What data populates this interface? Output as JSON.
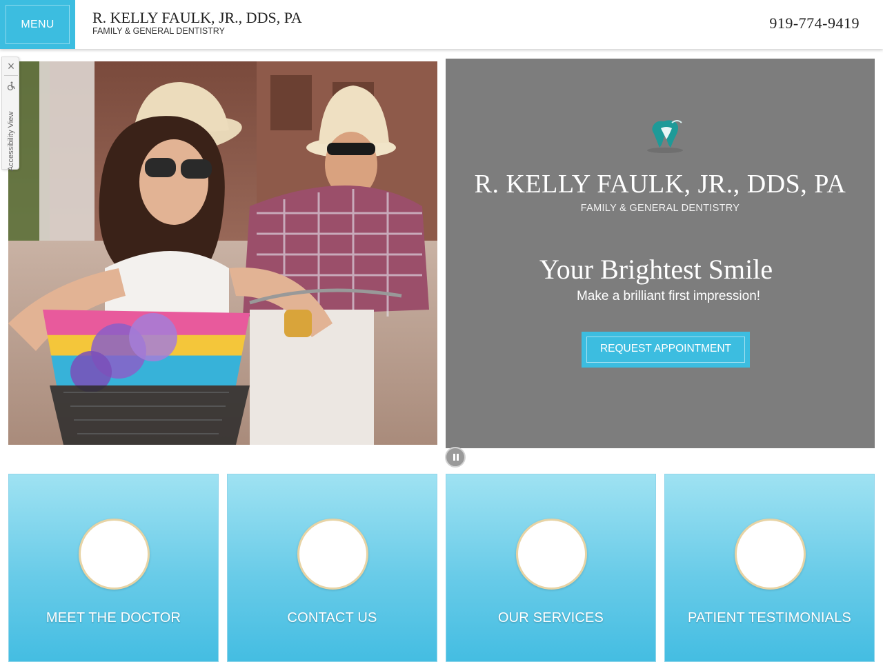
{
  "header": {
    "menu_label": "MENU",
    "practice_name": "R. KELLY FAULK, JR., DDS, PA",
    "practice_subtitle": "FAMILY & GENERAL DENTISTRY",
    "phone": "919-774-9419"
  },
  "accessibility": {
    "label": "Accessibility View"
  },
  "hero": {
    "practice_name": "R. KELLY FAULK, JR., DDS, PA",
    "practice_subtitle": "FAMILY & GENERAL DENTISTRY",
    "headline": "Your Brightest Smile",
    "tagline": "Make a brilliant first impression!",
    "cta_label": "REQUEST APPOINTMENT"
  },
  "cards": [
    {
      "label": "MEET THE DOCTOR"
    },
    {
      "label": "CONTACT US"
    },
    {
      "label": "OUR SERVICES"
    },
    {
      "label": "PATIENT TESTIMONIALS"
    }
  ],
  "colors": {
    "accent": "#3cbde0",
    "hero_bg": "#7d7d7d",
    "circle_border": "#e7d3a4"
  },
  "icons": {
    "close": "close-icon",
    "accessibility": "wheelchair-icon",
    "logo": "tooth-logo-icon",
    "pause": "pause-icon"
  }
}
